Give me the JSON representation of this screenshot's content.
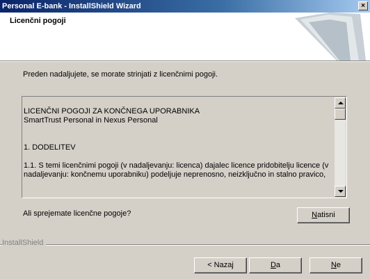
{
  "window": {
    "title": "Personal E-bank - InstallShield Wizard",
    "close_glyph": "×"
  },
  "header": {
    "heading": "Licenčni pogoji"
  },
  "intro": "Preden nadaljujete, se morate strinjati z licenčnimi pogoji.",
  "license": {
    "lines": [
      "LICENČNI POGOJI ZA KONČNEGA UPORABNIKA",
      "SmartTrust Personal in Nexus Personal",
      "1. DODELITEV",
      "1.1. S temi licenčnimi pogoji (v nadaljevanju: licenca) dajalec licence pridobitelju licence (v nadaljevanju: končnemu uporabniku) podeljuje neprenosno, neizključno in stalno pravico,"
    ]
  },
  "question": "Ali sprejemate licenčne pogoje?",
  "buttons": {
    "print": "Natisni",
    "back": "< Nazaj",
    "yes": "Da",
    "no": "Ne"
  },
  "footer": {
    "brand": "InstallShield"
  },
  "colors": {
    "titlebar_start": "#0a246a",
    "titlebar_end": "#a6caf0",
    "dialog_bg": "#d4d0c8"
  }
}
